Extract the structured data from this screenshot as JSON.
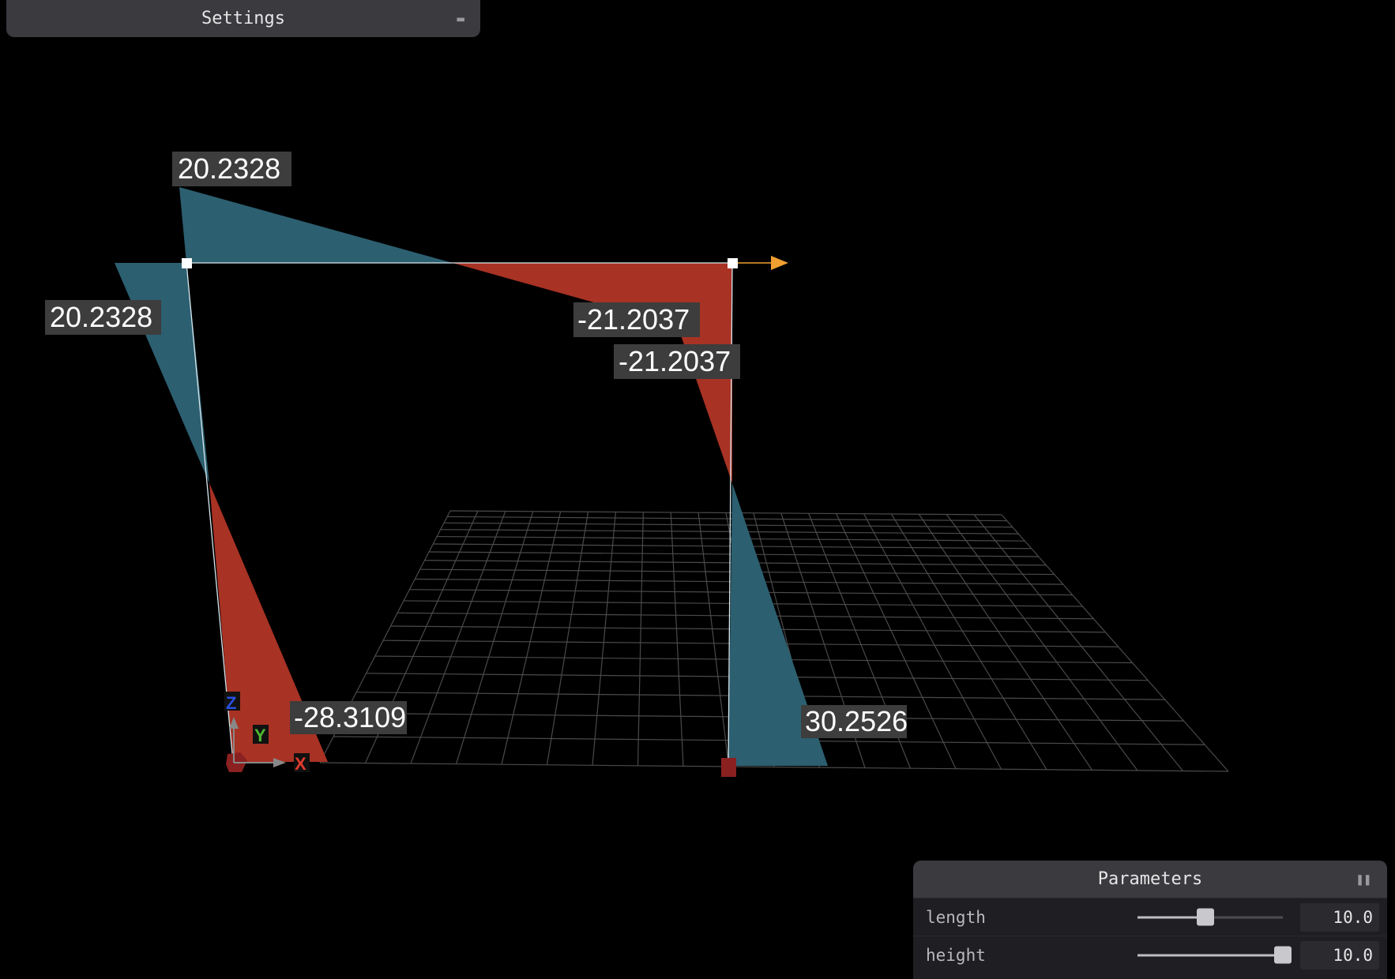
{
  "settings_bar": {
    "title": "Settings",
    "icon": "collapse-icon"
  },
  "parameters_panel": {
    "title": "Parameters",
    "icon": "pause-icon",
    "rows": [
      {
        "label": "length",
        "value": "10.0",
        "slider_fraction": 0.47
      },
      {
        "label": "height",
        "value": "10.0",
        "slider_fraction": 1.0
      }
    ]
  },
  "scene": {
    "value_labels": [
      "20.2328",
      "20.2328",
      "-21.2037",
      "-21.2037",
      "-28.3109",
      "30.2526"
    ],
    "axis_labels": {
      "x": "X",
      "y": "Y",
      "z": "Z"
    },
    "colors": {
      "positive": "#2c5f70",
      "negative": "#a83224",
      "grid": "#5a5a5a",
      "arrow": "#f0a030",
      "support": "#8b2020"
    }
  }
}
